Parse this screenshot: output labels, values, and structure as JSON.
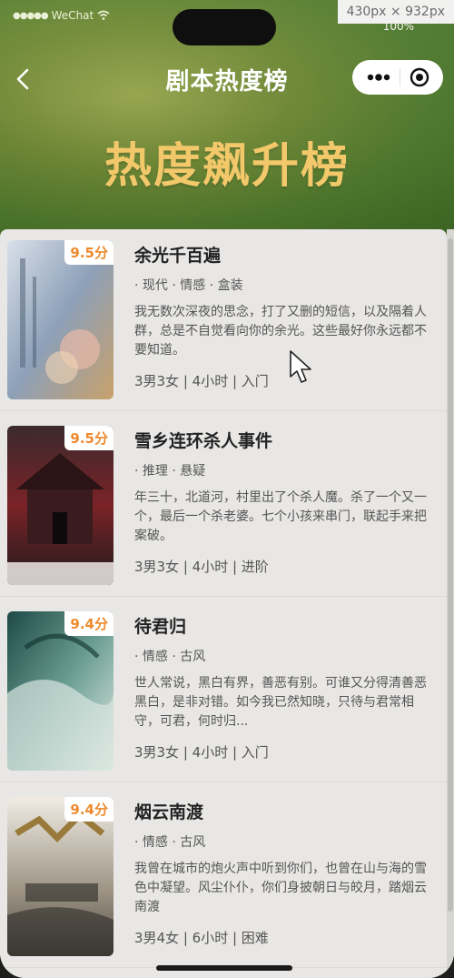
{
  "status": {
    "carrier": "WeChat",
    "signal_dots": "●●●●●",
    "battery": "100%",
    "viewport_size": "430px × 932px"
  },
  "nav": {
    "title": "剧本热度榜",
    "more_icon": "more-dots-icon",
    "close_icon": "target-circle-icon"
  },
  "hero": {
    "title": "热度飙升榜"
  },
  "scripts": [
    {
      "title": "余光千百遍",
      "score": "9.5分",
      "tags": "· 现代 · 情感 · 盒装",
      "desc": "我无数次深夜的思念，打了又删的短信，以及隔着人群，总是不自觉看向你的余光。这些最好你永远都不要知道。",
      "meta": "3男3女 | 4小时 | 入门",
      "cover_colors": [
        "#b8c5d6",
        "#7c8fa8",
        "#c7a87a"
      ]
    },
    {
      "title": "雪乡连环杀人事件",
      "score": "9.5分",
      "tags": "· 推理 · 悬疑",
      "desc": "年三十，北道河，村里出了个杀人魔。杀了一个又一个，最后一个杀老婆。七个小孩来串门，联起手来把案破。",
      "meta": "3男3女 | 4小时 | 进阶",
      "cover_colors": [
        "#2a1a1c",
        "#6b1f22",
        "#3a2c30"
      ]
    },
    {
      "title": "待君归",
      "score": "9.4分",
      "tags": "· 情感 · 古风",
      "desc": "世人常说，黑白有界，善恶有别。可谁又分得清善恶黑白，是非对错。如今我已然知晓，只待与君常相守，可君，何时归...",
      "meta": "3男3女 | 4小时 | 入门",
      "cover_colors": [
        "#2e5a55",
        "#5f8f86",
        "#c9d9d0"
      ]
    },
    {
      "title": "烟云南渡",
      "score": "9.4分",
      "tags": "· 情感 · 古风",
      "desc": "我曾在城市的炮火声中听到你们，也曾在山与海的雪色中凝望。风尘仆仆，你们身披朝日与皎月，踏烟云南渡",
      "meta": "3男4女 | 6小时 | 困难",
      "cover_colors": [
        "#dcd8cf",
        "#8f877a",
        "#b89b55"
      ]
    }
  ]
}
